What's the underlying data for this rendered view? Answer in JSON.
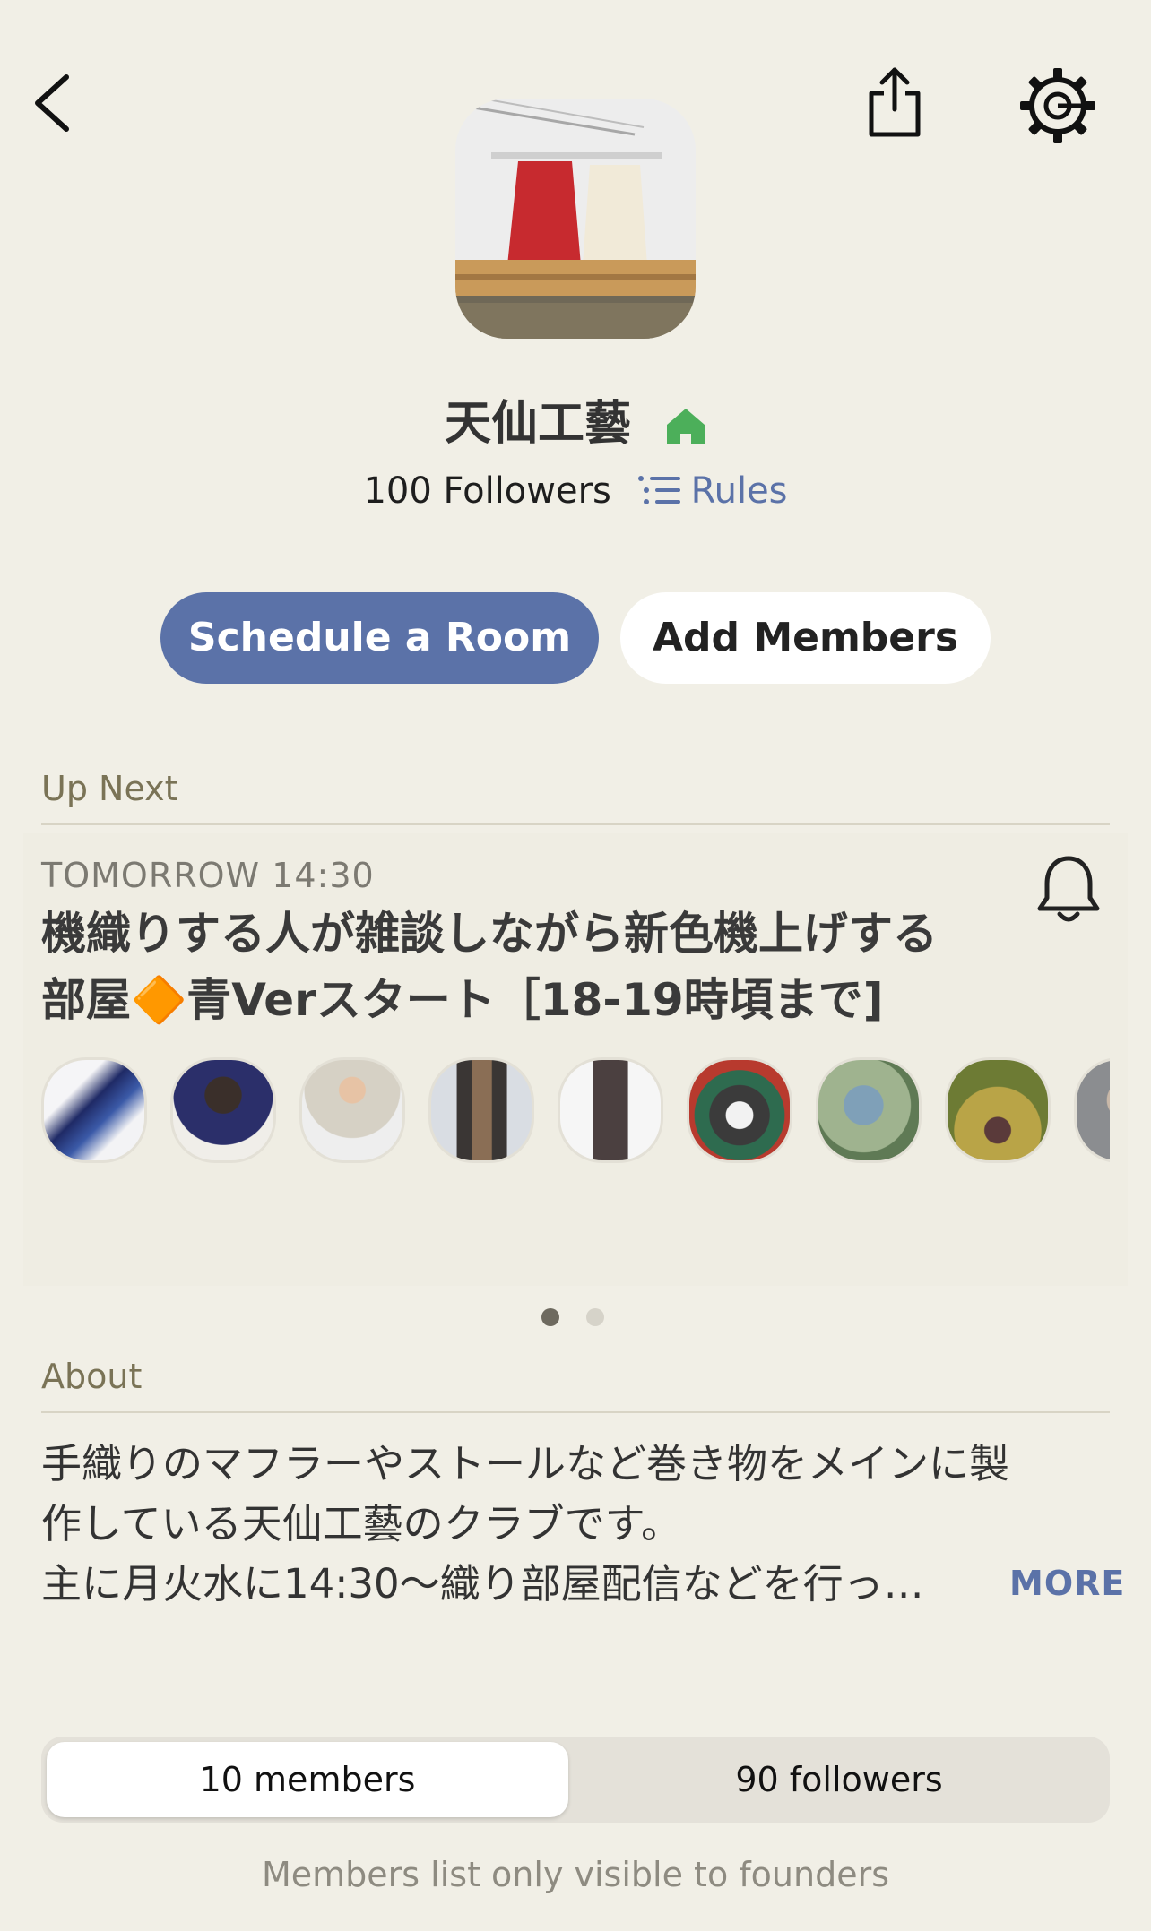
{
  "club": {
    "name": "天仙工藝",
    "followers_text": "100 Followers",
    "rules_label": "Rules",
    "home_icon": "house-icon"
  },
  "actions": {
    "schedule_label": "Schedule a Room",
    "add_members_label": "Add Members"
  },
  "up_next": {
    "section_label": "Up Next",
    "time": "TOMORROW 14:30",
    "title_line1": "機織りする人が雑談しながら新色機上げする",
    "title_line2": "部屋🔶青Verスタート［18-19時頃まで]",
    "pager": {
      "pages": 2,
      "active": 1
    }
  },
  "about": {
    "section_label": "About",
    "line1": "手織りのマフラーやストールなど巻き物をメインに製",
    "line2": "作している天仙工藝のクラブです。",
    "line3": "主に月火水に14:30〜織り部屋配信などを行っ…",
    "more_label": "MORE"
  },
  "tabs": {
    "members_label": "10 members",
    "followers_label": "90 followers",
    "active": "members"
  },
  "members_note": "Members list only visible to founders",
  "colors": {
    "background": "#f1efe6",
    "accent": "#5b72a8",
    "home_icon": "#4caf5a"
  }
}
